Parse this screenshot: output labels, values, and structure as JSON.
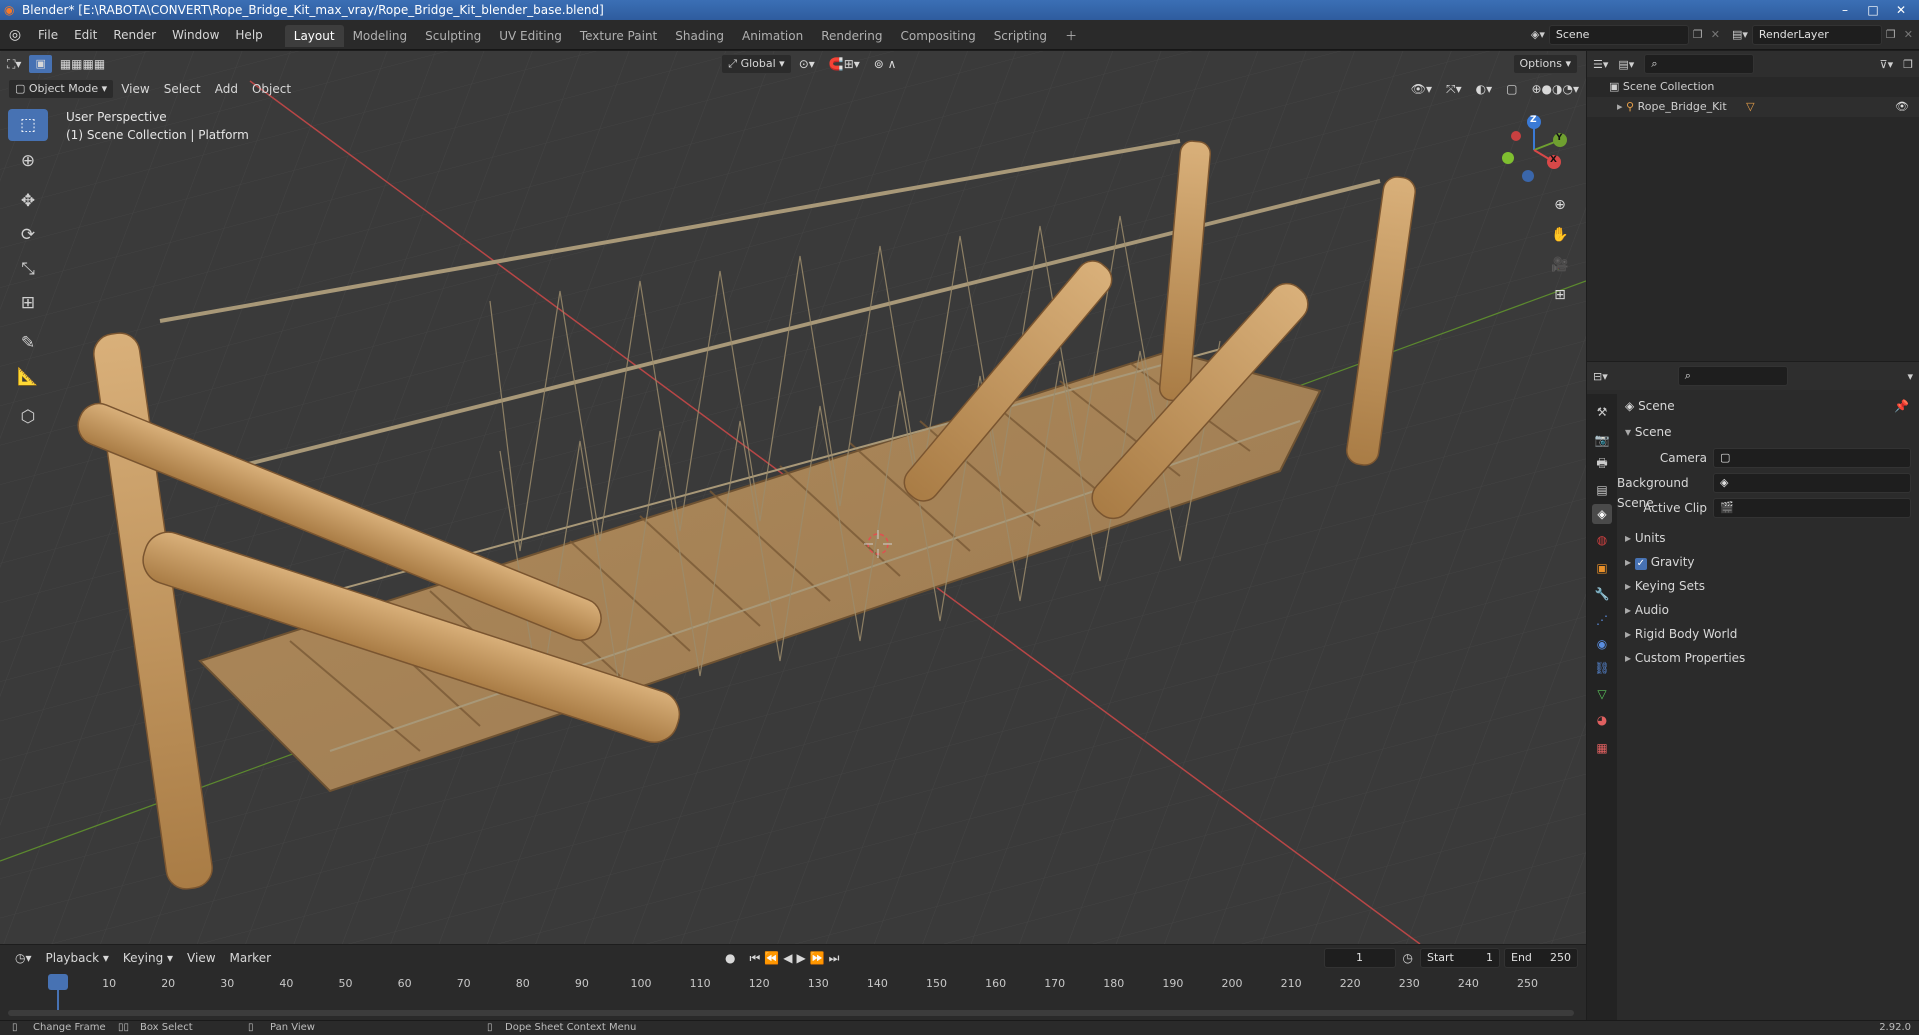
{
  "window": {
    "title": "Blender* [E:\\RABOTA\\CONVERT\\Rope_Bridge_Kit_max_vray/Rope_Bridge_Kit_blender_base.blend]",
    "controls": [
      "–",
      "□",
      "✕"
    ]
  },
  "menu": [
    "File",
    "Edit",
    "Render",
    "Window",
    "Help"
  ],
  "workspaces": [
    "Layout",
    "Modeling",
    "Sculpting",
    "UV Editing",
    "Texture Paint",
    "Shading",
    "Animation",
    "Rendering",
    "Compositing",
    "Scripting"
  ],
  "scene_field": "Scene",
  "renderlayer_field": "RenderLayer",
  "viewport_header": {
    "transform_orientation": "Global",
    "options": "Options",
    "mode": "Object Mode",
    "menus": [
      "View",
      "Select",
      "Add",
      "Object"
    ]
  },
  "viewport_overlay": {
    "line1": "User Perspective",
    "line2": "(1) Scene Collection | Platform"
  },
  "gizmo": {
    "z": "Z",
    "y": "Y",
    "x": "X"
  },
  "outliner": {
    "root": "Scene Collection",
    "items": [
      {
        "name": "Rope_Bridge_Kit"
      }
    ]
  },
  "properties": {
    "context_title": "Scene",
    "panel": "Scene",
    "fields": [
      {
        "label": "Camera"
      },
      {
        "label": "Background Scene"
      },
      {
        "label": "Active Clip"
      }
    ],
    "sections": [
      "Units",
      "Gravity",
      "Keying Sets",
      "Audio",
      "Rigid Body World",
      "Custom Properties"
    ],
    "gravity_checked": true
  },
  "timeline": {
    "menus": [
      "Playback",
      "Keying",
      "View",
      "Marker"
    ],
    "current_frame": "1",
    "start_label": "Start",
    "start": "1",
    "end_label": "End",
    "end": "250",
    "ticks": [
      "1",
      "10",
      "20",
      "30",
      "40",
      "50",
      "60",
      "70",
      "80",
      "90",
      "100",
      "110",
      "120",
      "130",
      "140",
      "150",
      "160",
      "170",
      "180",
      "190",
      "200",
      "210",
      "220",
      "230",
      "240",
      "250"
    ]
  },
  "statusbar": {
    "items": [
      "Change Frame",
      "Box Select",
      "Pan View",
      "Dope Sheet Context Menu"
    ],
    "version": "2.92.0"
  },
  "colors": {
    "accent": "#4772b3",
    "viewport_bg": "#3a3a3a",
    "wood": "#c49a5a",
    "rope": "#a89878",
    "x_axis": "#c94a4a",
    "y_axis": "#6a9a3a"
  }
}
